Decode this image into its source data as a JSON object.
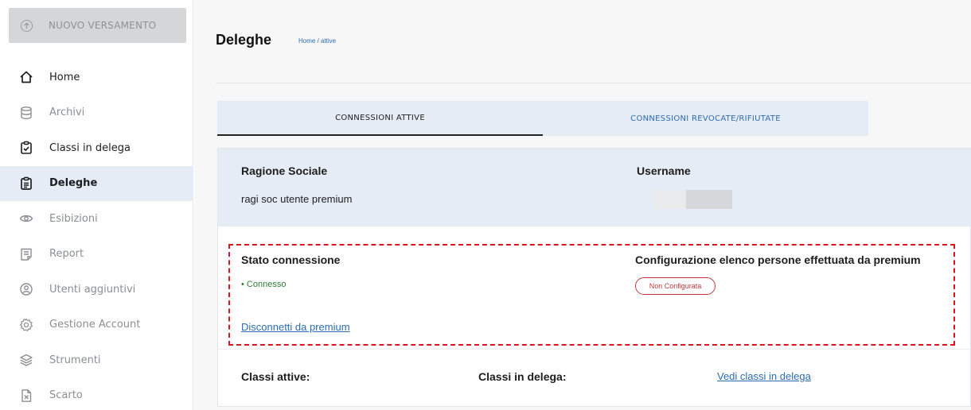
{
  "sidebar": {
    "new_button": "NUOVO VERSAMENTO",
    "items": [
      {
        "label": "Home",
        "icon": "home-icon"
      },
      {
        "label": "Archivi",
        "icon": "database-icon"
      },
      {
        "label": "Classi in delega",
        "icon": "clipboard-check-icon"
      },
      {
        "label": "Deleghe",
        "icon": "clipboard-list-icon"
      },
      {
        "label": "Esibizioni",
        "icon": "eye-icon"
      },
      {
        "label": "Report",
        "icon": "report-icon"
      },
      {
        "label": "Utenti aggiuntivi",
        "icon": "user-circle-icon"
      },
      {
        "label": "Gestione Account",
        "icon": "gear-icon"
      },
      {
        "label": "Strumenti",
        "icon": "layers-icon"
      },
      {
        "label": "Scarto",
        "icon": "file-x-icon"
      }
    ]
  },
  "header": {
    "title": "Deleghe",
    "breadcrumb": "Home / attive"
  },
  "tabs": [
    {
      "label": "CONNESSIONI ATTIVE"
    },
    {
      "label": "CONNESSIONI REVOCATE/RIFIUTATE"
    }
  ],
  "card": {
    "ragione_sociale_label": "Ragione Sociale",
    "ragione_sociale_value": "ragi soc utente premium",
    "username_label": "Username",
    "stato_label": "Stato connessione",
    "stato_value": "• Connesso",
    "config_label": "Configurazione elenco persone effettuata da premium",
    "config_badge": "Non Configurata",
    "disconnect_link": "Disconnetti da premium",
    "classi_attive_label": "Classi attive:",
    "classi_delega_label": "Classi in delega:",
    "vedi_link": "Vedi classi in delega"
  },
  "colors": {
    "accent_blue": "#2b6cb0",
    "tab_bg": "#e5ecf5",
    "status_green": "#2e7d32",
    "badge_red": "#c23a3f",
    "highlight_dash": "#d8161f"
  }
}
